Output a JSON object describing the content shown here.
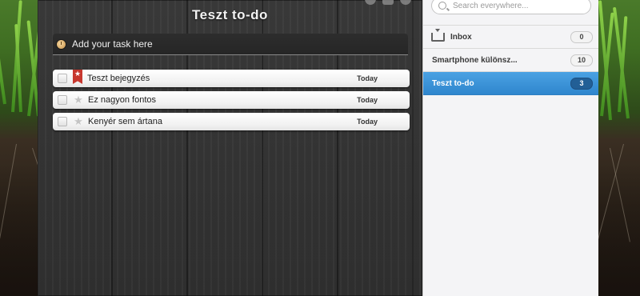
{
  "list_title": "Teszt to-do",
  "add_task_label": "Add your task here",
  "tasks": [
    {
      "label": "Teszt bejegyzés",
      "date": "Today",
      "starred": true
    },
    {
      "label": "Ez nagyon fontos",
      "date": "Today",
      "starred": false
    },
    {
      "label": "Kenyér sem ártana",
      "date": "Today",
      "starred": false
    }
  ],
  "search": {
    "placeholder": "Search everywhere..."
  },
  "sidebar": {
    "lists": [
      {
        "name": "Inbox",
        "count": "0",
        "icon": "inbox-icon"
      },
      {
        "name": "Smartphone különsz...",
        "count": "10"
      },
      {
        "name": "Teszt to-do",
        "count": "3",
        "active": true
      }
    ]
  },
  "colors": {
    "active_list": "#3A92D8",
    "star_flag": "#C7372E"
  }
}
